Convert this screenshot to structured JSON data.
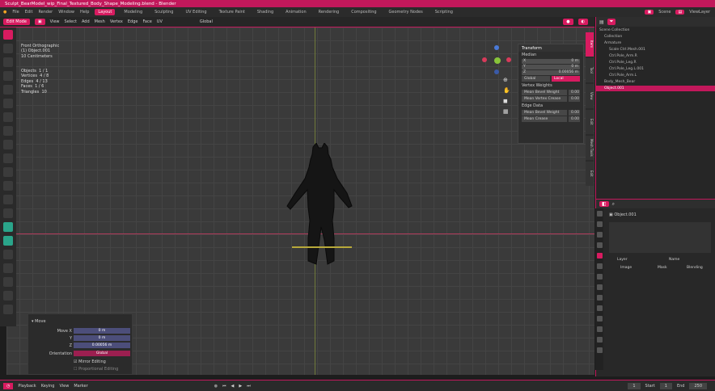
{
  "window": {
    "title": "Sculpt_BearModel_wip_Final_Textured_Body_Shape_Modeling.blend - Blender"
  },
  "menu": {
    "items": [
      "File",
      "Edit",
      "Render",
      "Window",
      "Help"
    ],
    "workspaces": [
      "Layout",
      "Modeling",
      "Sculpting",
      "UV Editing",
      "Texture Paint",
      "Shading",
      "Animation",
      "Rendering",
      "Compositing",
      "Geometry Nodes",
      "Scripting"
    ],
    "active_workspace": "Layout",
    "scene": "Scene",
    "view_layer": "ViewLayer"
  },
  "header": {
    "mode": "Edit Mode",
    "items": [
      "View",
      "Select",
      "Add",
      "Mesh",
      "Vertex",
      "Edge",
      "Face",
      "UV"
    ],
    "orientation": "Global"
  },
  "viewport_info": {
    "view": "Front Orthographic",
    "object": "(1) Object.001",
    "units": "10 Centimeters",
    "stats": [
      {
        "label": "Objects",
        "value": "1 / 1"
      },
      {
        "label": "Vertices",
        "value": "4 / 8"
      },
      {
        "label": "Edges",
        "value": "4 / 13"
      },
      {
        "label": "Faces",
        "value": "1 / 6"
      },
      {
        "label": "Triangles",
        "value": "10"
      }
    ]
  },
  "npanel": {
    "title": "Transform",
    "section": "Median",
    "fields": [
      {
        "axis": "X",
        "value": "0 m"
      },
      {
        "axis": "Y",
        "value": "0 m"
      },
      {
        "axis": "Z",
        "value": "0.00056 m"
      }
    ],
    "toggle": [
      "Global",
      "Local"
    ],
    "vertex_weights_label": "Vertex Weights",
    "buttons1": [
      "Mean Bevel Weight",
      "Mean Vertex Crease"
    ],
    "edge_label": "Edge Data",
    "buttons2": [
      "Mean Bevel Weight",
      "Mean Crease"
    ],
    "button_values": [
      "0.00",
      "0.00",
      "0.00",
      "0.00"
    ],
    "side_tabs": [
      "Item",
      "Tool",
      "View",
      "Edit",
      "Mesh Tools",
      "Edit"
    ]
  },
  "redo_panel": {
    "title": "Move",
    "rows": [
      {
        "label": "Move X",
        "value": "0 m"
      },
      {
        "label": "Y",
        "value": "0 m"
      },
      {
        "label": "Z",
        "value": "0.00056 m"
      },
      {
        "label": "Orientation",
        "value": "Global"
      }
    ],
    "check1": "Mirror Editing",
    "check2": "Proportional Editing"
  },
  "outliner": {
    "title": "Scene Collection",
    "items": [
      {
        "label": "Collection",
        "selected": false
      },
      {
        "label": "Armature",
        "selected": false
      },
      {
        "label": "Scale Ctrl.Mesh.001",
        "selected": false
      },
      {
        "label": "Ctrl.Pole_Arm.R",
        "selected": false
      },
      {
        "label": "Ctrl.Pole_Leg.R",
        "selected": false
      },
      {
        "label": "Ctrl.Pole_Leg.L.001",
        "selected": false
      },
      {
        "label": "Ctrl.Pole_Arm.L",
        "selected": false
      },
      {
        "label": "Body_Mesh_Bear",
        "selected": false
      },
      {
        "label": "Object.001",
        "selected": true
      }
    ]
  },
  "properties": {
    "object_name": "Object.001",
    "columns": [
      "Name",
      "Layer"
    ],
    "subcols": [
      "Image",
      "Mask",
      "Blending"
    ]
  },
  "statusbar": {
    "mode": "Playback",
    "keying": "Keying",
    "items": [
      "View",
      "Marker"
    ],
    "frame": "1",
    "start_label": "Start",
    "start": "1",
    "end_label": "End",
    "end": "250"
  }
}
